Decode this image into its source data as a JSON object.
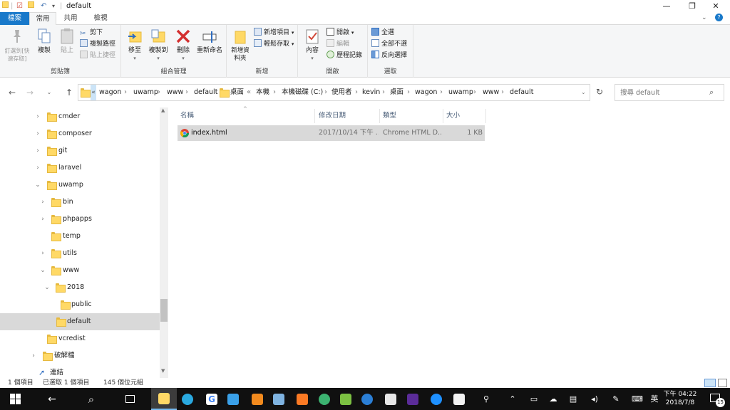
{
  "window": {
    "title": "default",
    "minimize": "—",
    "maximize": "❐",
    "close": "✕"
  },
  "ribbon_tabs": {
    "file": "檔案",
    "home": "常用",
    "share": "共用",
    "view": "檢視"
  },
  "clipboard": {
    "pin": "釘選到[快速存取]",
    "copy": "複製",
    "paste": "貼上",
    "cut": "剪下",
    "copy_path": "複製路徑",
    "paste_shortcut": "貼上捷徑",
    "label": "剪貼簿"
  },
  "organize": {
    "move_to": "移至",
    "copy_to": "複製到",
    "delete": "刪除",
    "rename": "重新命名",
    "label": "組合管理"
  },
  "new_group": {
    "new_folder": "新增資料夾",
    "new_item": "新增項目",
    "easy_access": "輕鬆存取",
    "label": "新增"
  },
  "open_group": {
    "properties": "內容",
    "open": "開啟",
    "edit": "編輯",
    "history": "歷程記錄",
    "label": "開啟"
  },
  "select_group": {
    "select_all": "全選",
    "select_none": "全部不選",
    "invert": "反向選擇",
    "label": "選取"
  },
  "address": {
    "crumbs": [
      "wagon",
      "uwamp",
      "www",
      "default",
      "桌面",
      "本機",
      "本機磁碟 (C:)",
      "使用者",
      "kevin",
      "桌面",
      "wagon",
      "uwamp",
      "www",
      "default"
    ]
  },
  "search": {
    "placeholder": "搜尋 default"
  },
  "nav_tree": [
    {
      "label": "cmder"
    },
    {
      "label": "composer"
    },
    {
      "label": "git"
    },
    {
      "label": "laravel"
    },
    {
      "label": "uwamp"
    },
    {
      "label": "bin"
    },
    {
      "label": "phpapps"
    },
    {
      "label": "temp"
    },
    {
      "label": "utils"
    },
    {
      "label": "www"
    },
    {
      "label": "2018"
    },
    {
      "label": "public"
    },
    {
      "label": "default"
    },
    {
      "label": "vcredist"
    },
    {
      "label": "破解檔"
    },
    {
      "label": "連結"
    }
  ],
  "columns": {
    "name": "名稱",
    "modified": "修改日期",
    "type": "類型",
    "size": "大小"
  },
  "files": [
    {
      "name": "index.html",
      "modified": "2017/10/14 下午 ...",
      "type": "Chrome HTML D...",
      "size": "1 KB"
    }
  ],
  "status": {
    "count": "1 個項目",
    "selected": "已選取 1 個項目",
    "size": "145 個位元組"
  },
  "taskbar": {
    "ime": "英",
    "time": "下午 04:22",
    "date": "2018/7/8",
    "notifications": "15"
  }
}
